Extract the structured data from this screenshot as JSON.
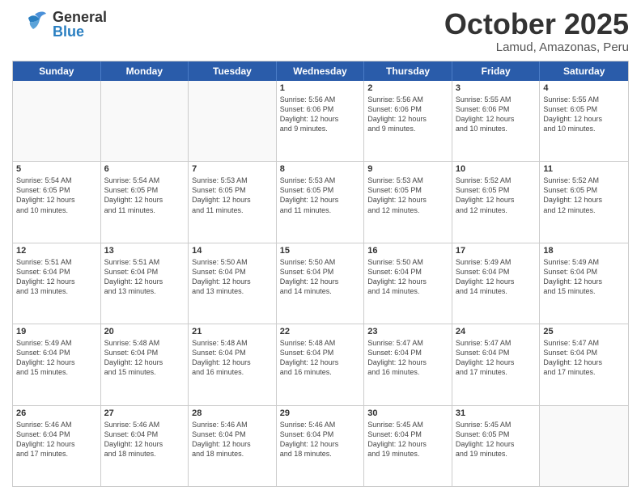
{
  "header": {
    "logo": {
      "general": "General",
      "blue": "Blue"
    },
    "title": "October 2025",
    "location": "Lamud, Amazonas, Peru"
  },
  "calendar": {
    "days_of_week": [
      "Sunday",
      "Monday",
      "Tuesday",
      "Wednesday",
      "Thursday",
      "Friday",
      "Saturday"
    ],
    "weeks": [
      [
        {
          "day": "",
          "info": "",
          "empty": true
        },
        {
          "day": "",
          "info": "",
          "empty": true
        },
        {
          "day": "",
          "info": "",
          "empty": true
        },
        {
          "day": "1",
          "info": "Sunrise: 5:56 AM\nSunset: 6:06 PM\nDaylight: 12 hours\nand 9 minutes.",
          "empty": false
        },
        {
          "day": "2",
          "info": "Sunrise: 5:56 AM\nSunset: 6:06 PM\nDaylight: 12 hours\nand 9 minutes.",
          "empty": false
        },
        {
          "day": "3",
          "info": "Sunrise: 5:55 AM\nSunset: 6:06 PM\nDaylight: 12 hours\nand 10 minutes.",
          "empty": false
        },
        {
          "day": "4",
          "info": "Sunrise: 5:55 AM\nSunset: 6:05 PM\nDaylight: 12 hours\nand 10 minutes.",
          "empty": false
        }
      ],
      [
        {
          "day": "5",
          "info": "Sunrise: 5:54 AM\nSunset: 6:05 PM\nDaylight: 12 hours\nand 10 minutes.",
          "empty": false
        },
        {
          "day": "6",
          "info": "Sunrise: 5:54 AM\nSunset: 6:05 PM\nDaylight: 12 hours\nand 11 minutes.",
          "empty": false
        },
        {
          "day": "7",
          "info": "Sunrise: 5:53 AM\nSunset: 6:05 PM\nDaylight: 12 hours\nand 11 minutes.",
          "empty": false
        },
        {
          "day": "8",
          "info": "Sunrise: 5:53 AM\nSunset: 6:05 PM\nDaylight: 12 hours\nand 11 minutes.",
          "empty": false
        },
        {
          "day": "9",
          "info": "Sunrise: 5:53 AM\nSunset: 6:05 PM\nDaylight: 12 hours\nand 12 minutes.",
          "empty": false
        },
        {
          "day": "10",
          "info": "Sunrise: 5:52 AM\nSunset: 6:05 PM\nDaylight: 12 hours\nand 12 minutes.",
          "empty": false
        },
        {
          "day": "11",
          "info": "Sunrise: 5:52 AM\nSunset: 6:05 PM\nDaylight: 12 hours\nand 12 minutes.",
          "empty": false
        }
      ],
      [
        {
          "day": "12",
          "info": "Sunrise: 5:51 AM\nSunset: 6:04 PM\nDaylight: 12 hours\nand 13 minutes.",
          "empty": false
        },
        {
          "day": "13",
          "info": "Sunrise: 5:51 AM\nSunset: 6:04 PM\nDaylight: 12 hours\nand 13 minutes.",
          "empty": false
        },
        {
          "day": "14",
          "info": "Sunrise: 5:50 AM\nSunset: 6:04 PM\nDaylight: 12 hours\nand 13 minutes.",
          "empty": false
        },
        {
          "day": "15",
          "info": "Sunrise: 5:50 AM\nSunset: 6:04 PM\nDaylight: 12 hours\nand 14 minutes.",
          "empty": false
        },
        {
          "day": "16",
          "info": "Sunrise: 5:50 AM\nSunset: 6:04 PM\nDaylight: 12 hours\nand 14 minutes.",
          "empty": false
        },
        {
          "day": "17",
          "info": "Sunrise: 5:49 AM\nSunset: 6:04 PM\nDaylight: 12 hours\nand 14 minutes.",
          "empty": false
        },
        {
          "day": "18",
          "info": "Sunrise: 5:49 AM\nSunset: 6:04 PM\nDaylight: 12 hours\nand 15 minutes.",
          "empty": false
        }
      ],
      [
        {
          "day": "19",
          "info": "Sunrise: 5:49 AM\nSunset: 6:04 PM\nDaylight: 12 hours\nand 15 minutes.",
          "empty": false
        },
        {
          "day": "20",
          "info": "Sunrise: 5:48 AM\nSunset: 6:04 PM\nDaylight: 12 hours\nand 15 minutes.",
          "empty": false
        },
        {
          "day": "21",
          "info": "Sunrise: 5:48 AM\nSunset: 6:04 PM\nDaylight: 12 hours\nand 16 minutes.",
          "empty": false
        },
        {
          "day": "22",
          "info": "Sunrise: 5:48 AM\nSunset: 6:04 PM\nDaylight: 12 hours\nand 16 minutes.",
          "empty": false
        },
        {
          "day": "23",
          "info": "Sunrise: 5:47 AM\nSunset: 6:04 PM\nDaylight: 12 hours\nand 16 minutes.",
          "empty": false
        },
        {
          "day": "24",
          "info": "Sunrise: 5:47 AM\nSunset: 6:04 PM\nDaylight: 12 hours\nand 17 minutes.",
          "empty": false
        },
        {
          "day": "25",
          "info": "Sunrise: 5:47 AM\nSunset: 6:04 PM\nDaylight: 12 hours\nand 17 minutes.",
          "empty": false
        }
      ],
      [
        {
          "day": "26",
          "info": "Sunrise: 5:46 AM\nSunset: 6:04 PM\nDaylight: 12 hours\nand 17 minutes.",
          "empty": false
        },
        {
          "day": "27",
          "info": "Sunrise: 5:46 AM\nSunset: 6:04 PM\nDaylight: 12 hours\nand 18 minutes.",
          "empty": false
        },
        {
          "day": "28",
          "info": "Sunrise: 5:46 AM\nSunset: 6:04 PM\nDaylight: 12 hours\nand 18 minutes.",
          "empty": false
        },
        {
          "day": "29",
          "info": "Sunrise: 5:46 AM\nSunset: 6:04 PM\nDaylight: 12 hours\nand 18 minutes.",
          "empty": false
        },
        {
          "day": "30",
          "info": "Sunrise: 5:45 AM\nSunset: 6:04 PM\nDaylight: 12 hours\nand 19 minutes.",
          "empty": false
        },
        {
          "day": "31",
          "info": "Sunrise: 5:45 AM\nSunset: 6:05 PM\nDaylight: 12 hours\nand 19 minutes.",
          "empty": false
        },
        {
          "day": "",
          "info": "",
          "empty": true
        }
      ]
    ]
  }
}
